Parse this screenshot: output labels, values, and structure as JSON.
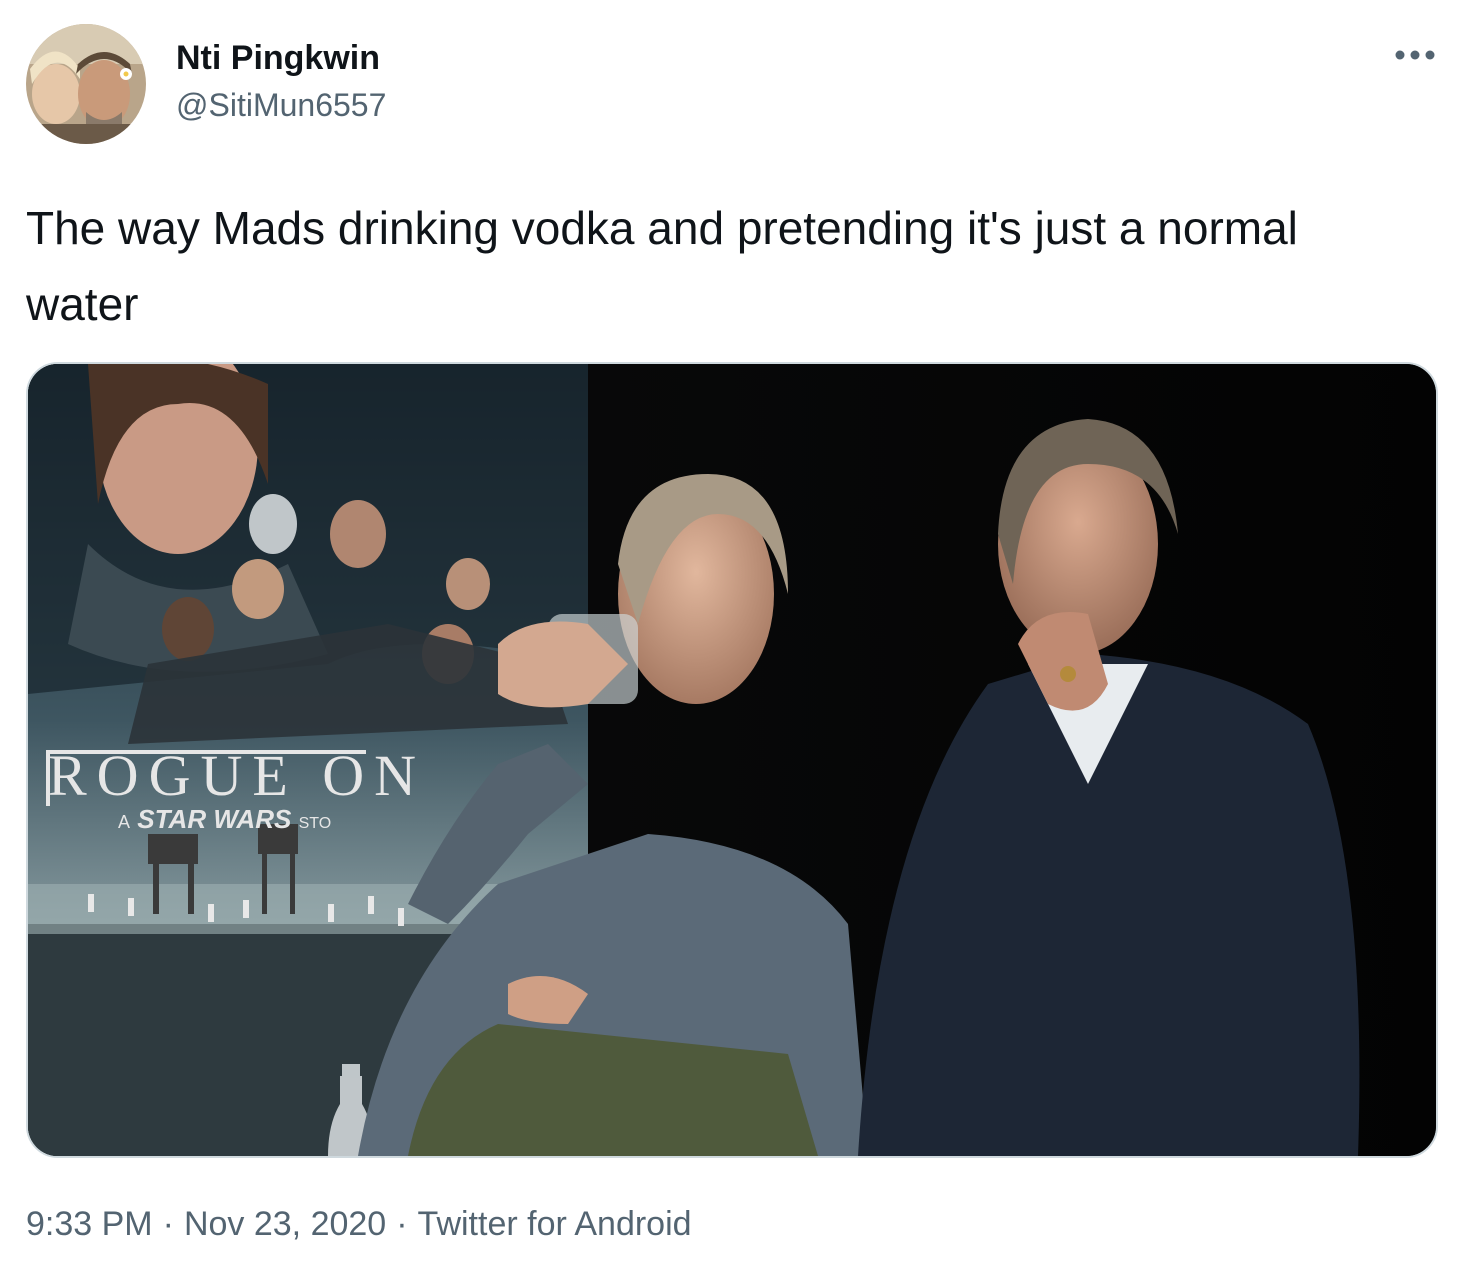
{
  "author": {
    "display_name": "Nti Pingkwin",
    "handle": "@SitiMun6557",
    "avatar_icon": "user-avatar-photo"
  },
  "more_icon": "more-horizontal-icon",
  "tweet": {
    "text": "The way Mads drinking vodka and pretending it's just a normal water"
  },
  "media": {
    "poster_title": "ROGUE ON",
    "poster_subtitle_a": "A",
    "poster_subtitle_brand": "STAR WARS",
    "poster_subtitle_tail": "STO"
  },
  "meta": {
    "time": "9:33 PM",
    "separator": "·",
    "date": "Nov 23, 2020",
    "source": "Twitter for Android"
  },
  "colors": {
    "text_primary": "#0f1419",
    "text_secondary": "#536471",
    "media_border": "#cfd9de"
  }
}
